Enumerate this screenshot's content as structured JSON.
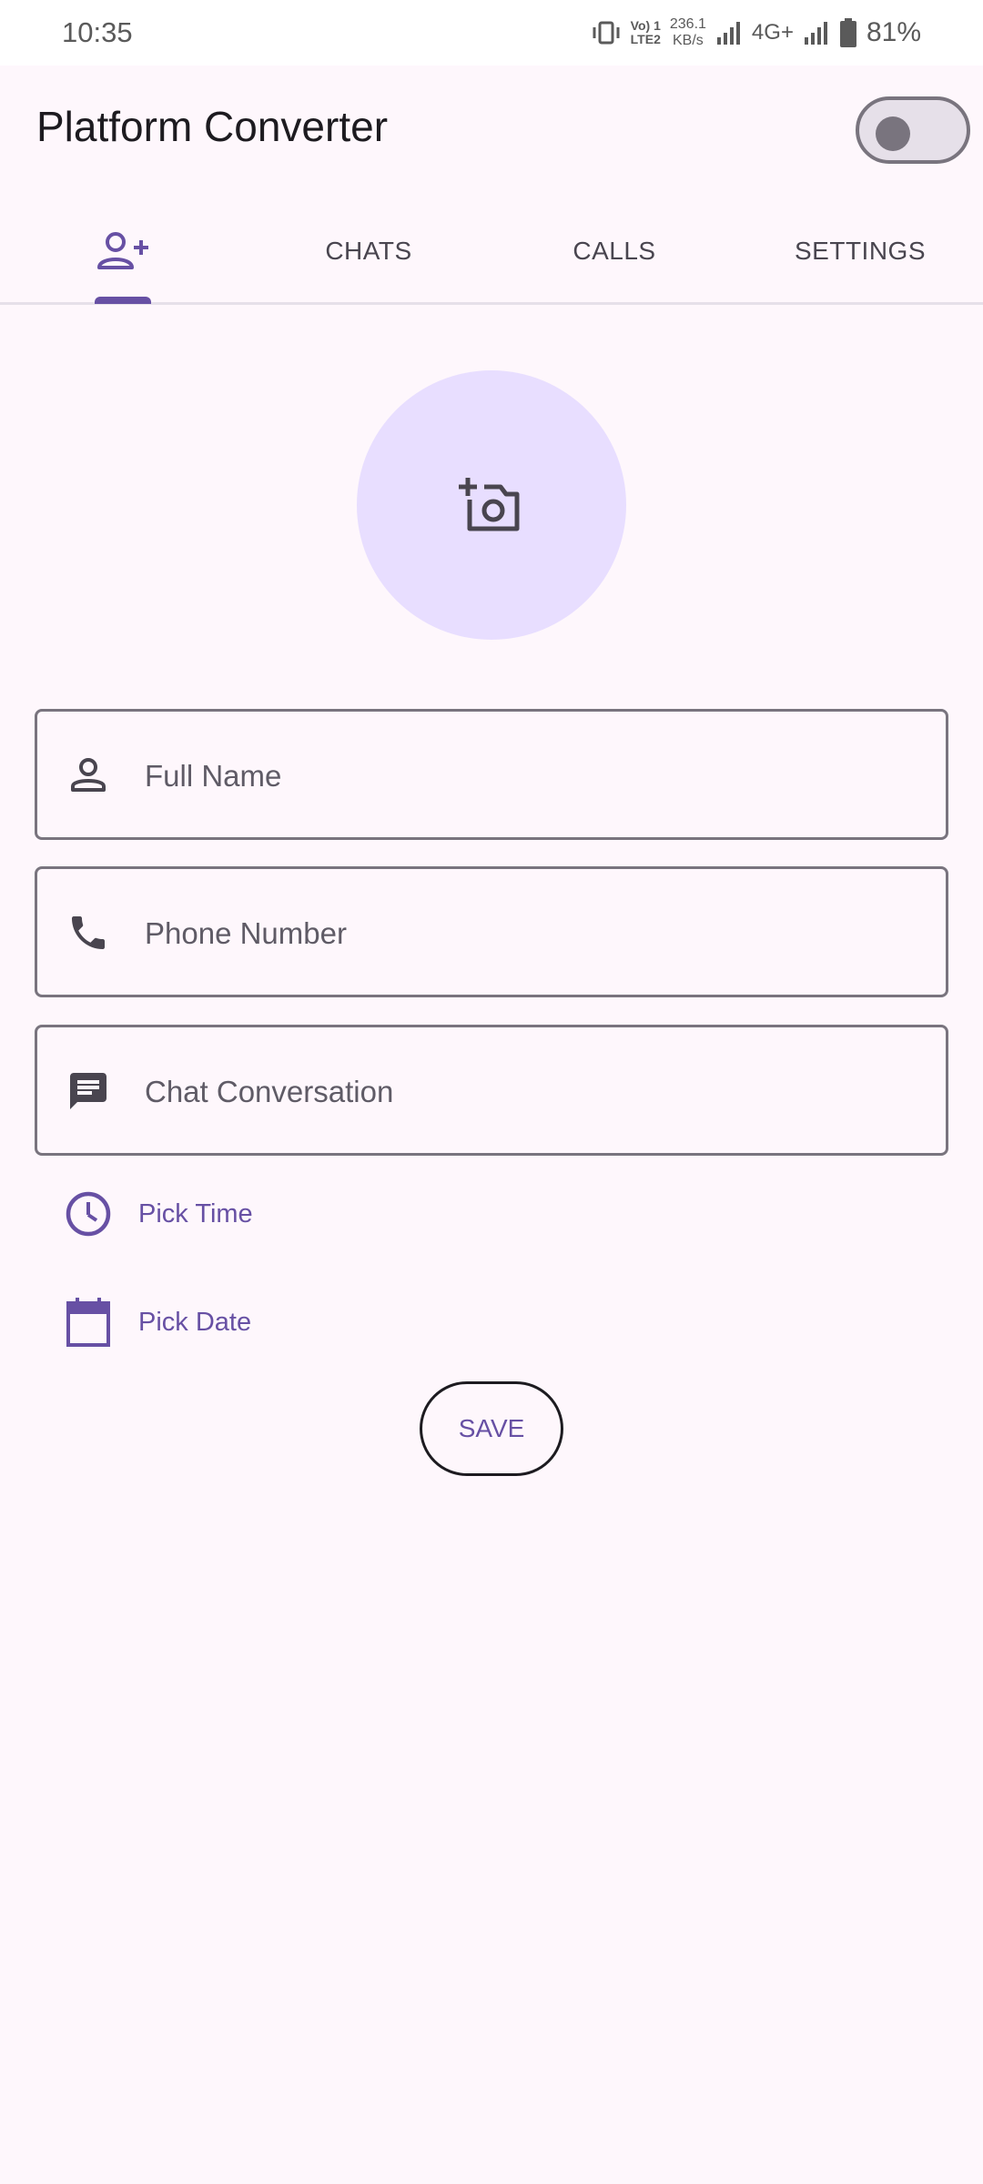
{
  "status_bar": {
    "time": "10:35",
    "volte_line1": "Vo) 1",
    "volte_line2": "LTE2",
    "speed_value": "236.1",
    "speed_unit": "KB/s",
    "network_type": "4G+",
    "battery_percent": "81%"
  },
  "app_bar": {
    "title": "Platform Converter",
    "theme_toggle_on": false
  },
  "tabs": [
    {
      "icon": "person-add-icon",
      "label": "",
      "selected": true
    },
    {
      "label": "CHATS",
      "selected": false
    },
    {
      "label": "CALLS",
      "selected": false
    },
    {
      "label": "SETTINGS",
      "selected": false
    }
  ],
  "avatar": {
    "icon": "add-photo-camera-icon"
  },
  "form": {
    "full_name": {
      "icon": "person-icon",
      "placeholder": "Full Name",
      "value": ""
    },
    "phone": {
      "icon": "phone-icon",
      "placeholder": "Phone Number",
      "value": ""
    },
    "chat": {
      "icon": "chat-message-icon",
      "placeholder": "Chat Conversation",
      "value": ""
    }
  },
  "pick_time": {
    "icon": "clock-icon",
    "label": "Pick Time"
  },
  "pick_date": {
    "icon": "calendar-icon",
    "label": "Pick Date"
  },
  "save_label": "SAVE",
  "colors": {
    "background": "#FEF7FC",
    "primary": "#6750A4",
    "avatar_bg": "#E8DEFF",
    "outline": "#79747E",
    "text": "#1D1B20"
  }
}
